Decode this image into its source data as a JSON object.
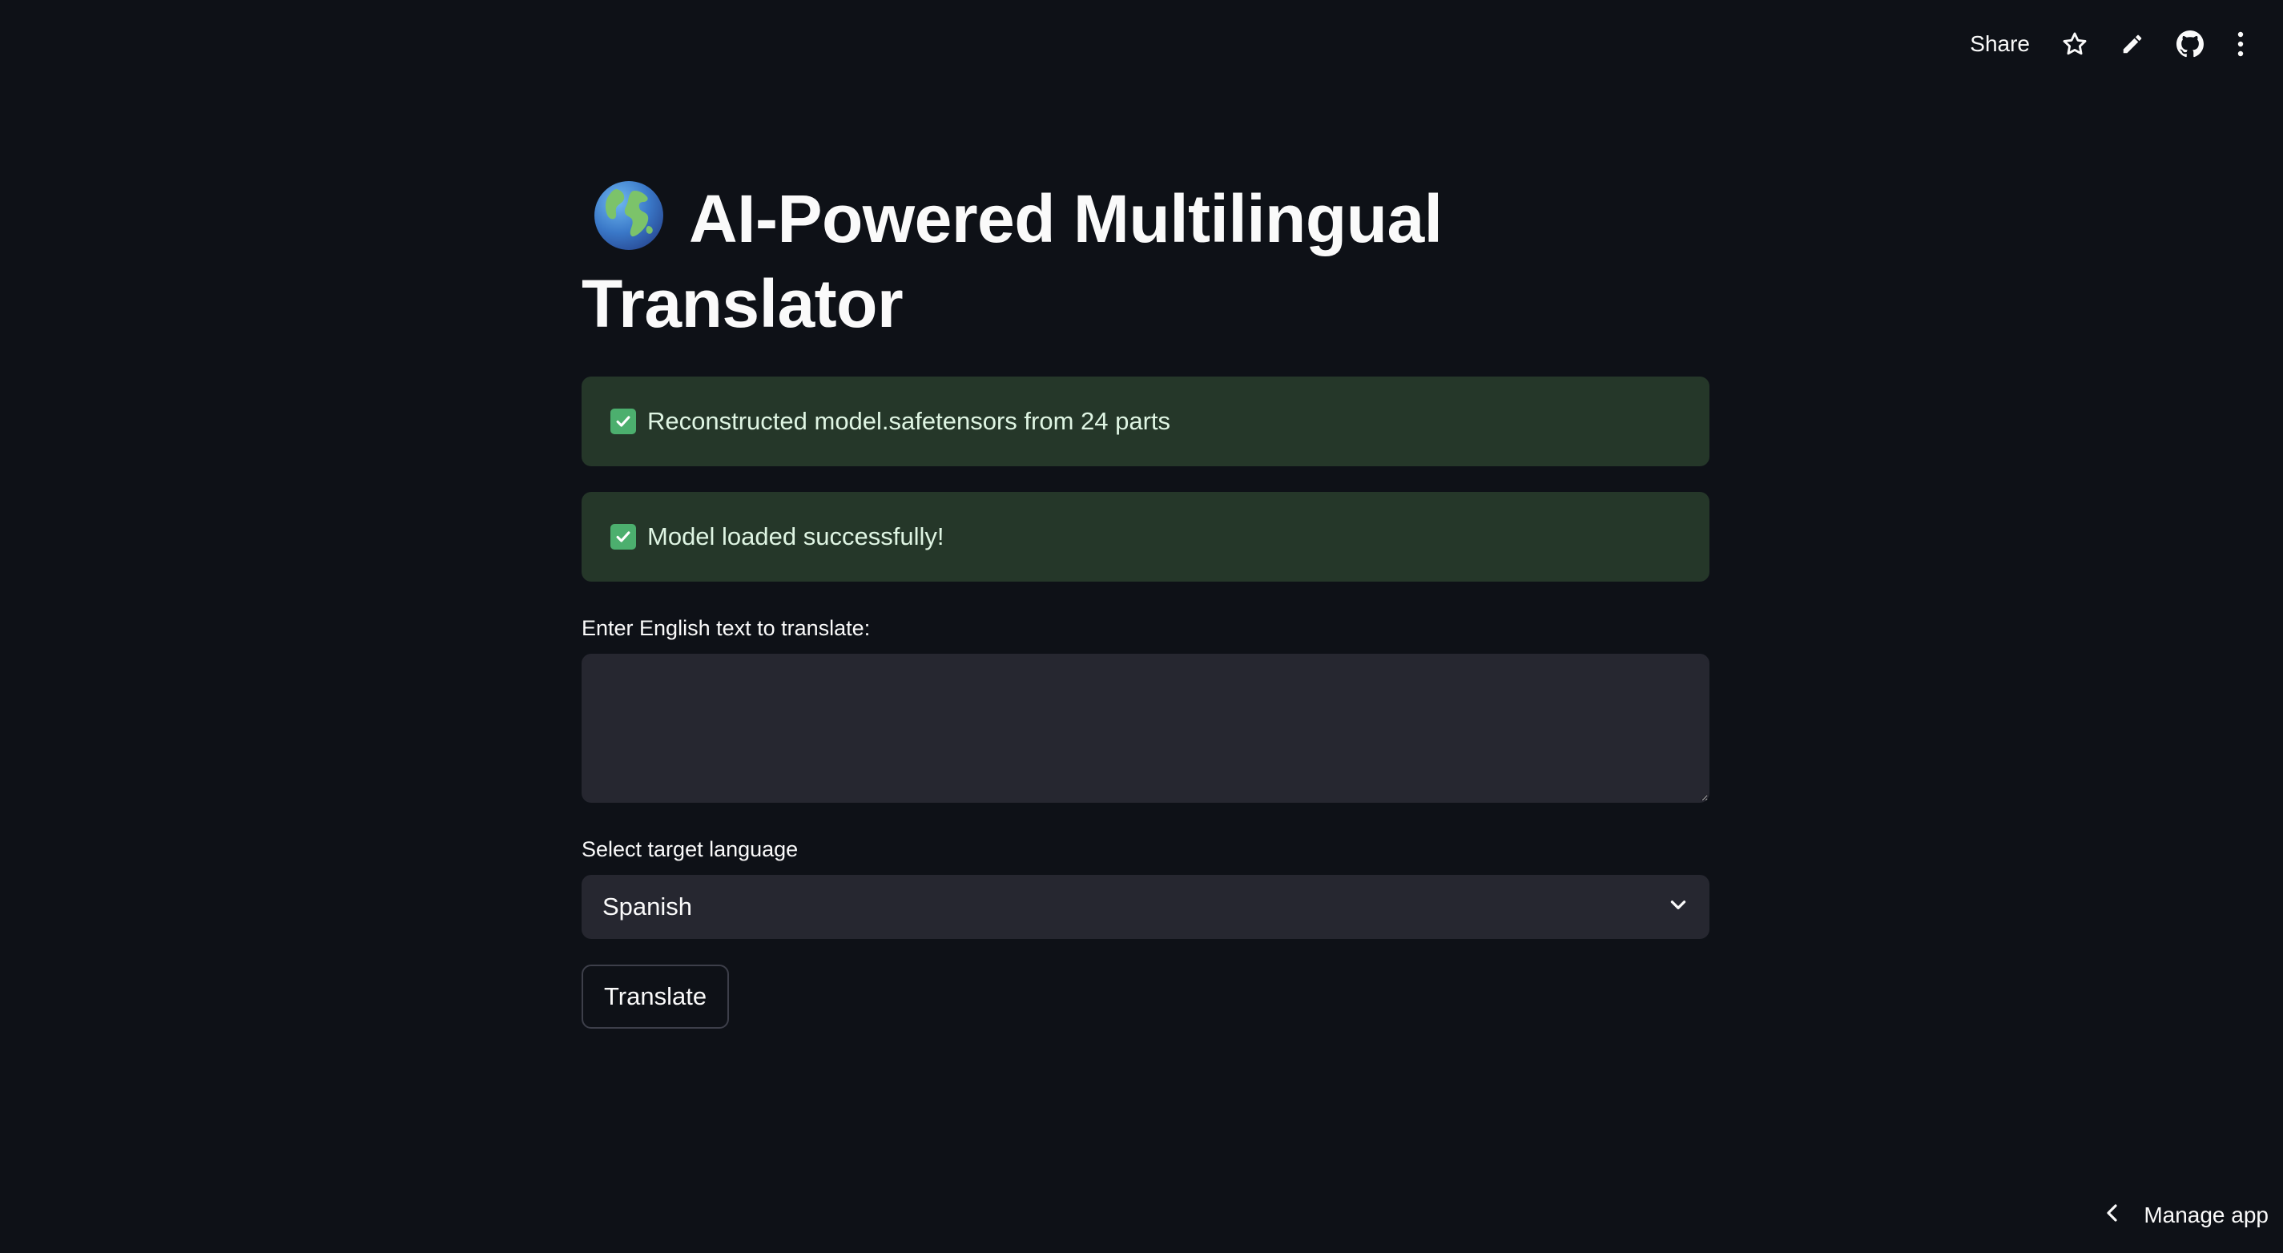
{
  "toolbar": {
    "share_label": "Share",
    "icons": [
      "star-icon",
      "pencil-icon",
      "github-icon",
      "kebab-menu-icon"
    ]
  },
  "main": {
    "title_icon": "globe-icon",
    "title": "AI-Powered Multilingual Translator",
    "alerts": [
      {
        "icon": "check-icon",
        "text": "Reconstructed model.safetensors from 24 parts"
      },
      {
        "icon": "check-icon",
        "text": "Model loaded successfully!"
      }
    ],
    "text_input": {
      "label": "Enter English text to translate:",
      "value": "",
      "placeholder": ""
    },
    "language_select": {
      "label": "Select target language",
      "value": "Spanish"
    },
    "translate_label": "Translate"
  },
  "footer": {
    "manage_label": "Manage app"
  },
  "colors": {
    "background": "#0e1117",
    "success_bg": "#253729",
    "input_bg": "#262730",
    "text": "#fafafa"
  }
}
